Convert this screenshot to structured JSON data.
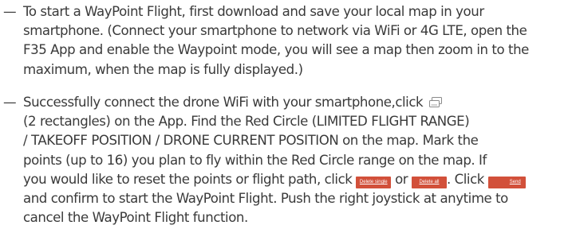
{
  "bullet_marker": "—",
  "bullet1": {
    "lines": [
      "To start a WayPoint Flight, first download and save your local map in your",
      "smartphone. (Connect your smartphone to network via WiFi or 4G LTE, open the",
      "F35 App and enable the Waypoint mode, you will see a map then zoom in to the",
      "maximum, when the map is fully displayed.)"
    ]
  },
  "bullet2": {
    "line1": "Successfully connect the drone WiFi with your smartphone,click",
    "line2": "(2 rectangles) on the App. Find the Red Circle (LIMITED FLIGHT RANGE)",
    "line3": "/ TAKEOFF POSITION / DRONE CURRENT POSITION on the map. Mark the",
    "line4": "points (up to 16) you plan to fly within the Red Circle range on the map. If",
    "line5_a": "you would like to reset the points or flight path, click",
    "line5_or": "or",
    "line5_b": ". Click",
    "line6": "and confirm to start the WayPoint Flight. Push the right joystick at anytime to",
    "line7": "cancel the WayPoint Flight function."
  },
  "buttons": {
    "delete_single": "Delete single",
    "delete_all": "Delete all",
    "send": "Send"
  },
  "icons": {
    "rectangles": "two-rectangles-icon"
  },
  "colors": {
    "text": "#3a3a3a",
    "button_bg": "#d2503a",
    "button_text": "#ffffff"
  }
}
